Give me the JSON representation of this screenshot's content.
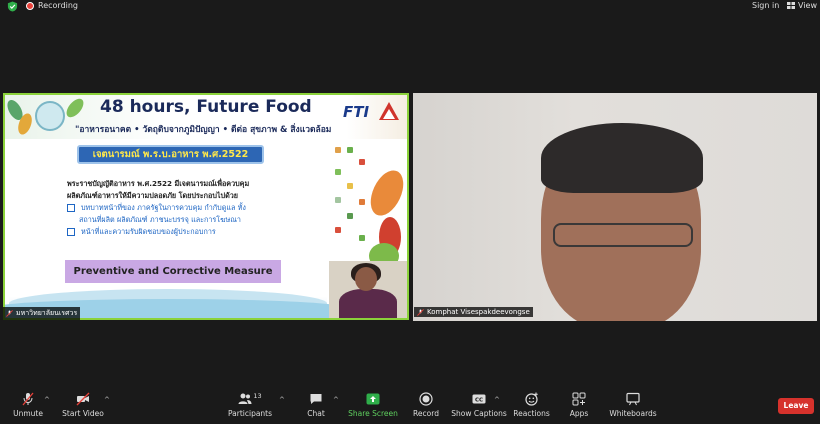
{
  "topbar": {
    "recording_label": "Recording",
    "signin_label": "Sign in",
    "view_label": "View"
  },
  "shared_screen": {
    "banner_title": "48 hours, Future Food",
    "banner_subtitle": "\"อาหารอนาคต • วัตถุดิบจากภูมิปัญญา • ดีต่อ สุขภาพ & สิ่งแวดล้อม",
    "banner_logo_text": "FTI",
    "slide_heading": "เจตนารมณ์ พ.ร.บ.อาหาร พ.ศ.2522",
    "slide_paragraph_line1": "พระราชบัญญัติอาหาร พ.ศ.2522 มีเจตนารมณ์เพื่อควบคุม",
    "slide_paragraph_line2": "ผลิตภัณฑ์อาหารให้มีความปลอดภัย โดยประกอบไปด้วย",
    "bullet1_line1": "บทบาทหน้าที่ของ ภาครัฐในการควบคุม กำกับดูแล ทั้ง",
    "bullet1_line2": "สถานที่ผลิต ผลิตภัณฑ์ ภาชนะบรรจุ และการโฆษณา",
    "bullet2": "หน้าที่และความรับผิดชอบของผู้ประกอบการ",
    "measure_box": "Preventive and Corrective Measure",
    "participant_name": "มหาวิทยาลัยนเรศวร"
  },
  "video_tile": {
    "participant_name": "Komphat Visespakdeevongse"
  },
  "toolbar": {
    "unmute": "Unmute",
    "start_video": "Start Video",
    "participants": "Participants",
    "participants_count": "13",
    "chat": "Chat",
    "share_screen": "Share Screen",
    "record": "Record",
    "show_captions": "Show Captions",
    "reactions": "Reactions",
    "apps": "Apps",
    "whiteboards": "Whiteboards",
    "leave": "Leave"
  },
  "colors": {
    "active_speaker_border": "#8bd23a",
    "leave_button": "#d6322c",
    "share_screen": "#5fd05f",
    "recording_dot": "#e8413a"
  }
}
